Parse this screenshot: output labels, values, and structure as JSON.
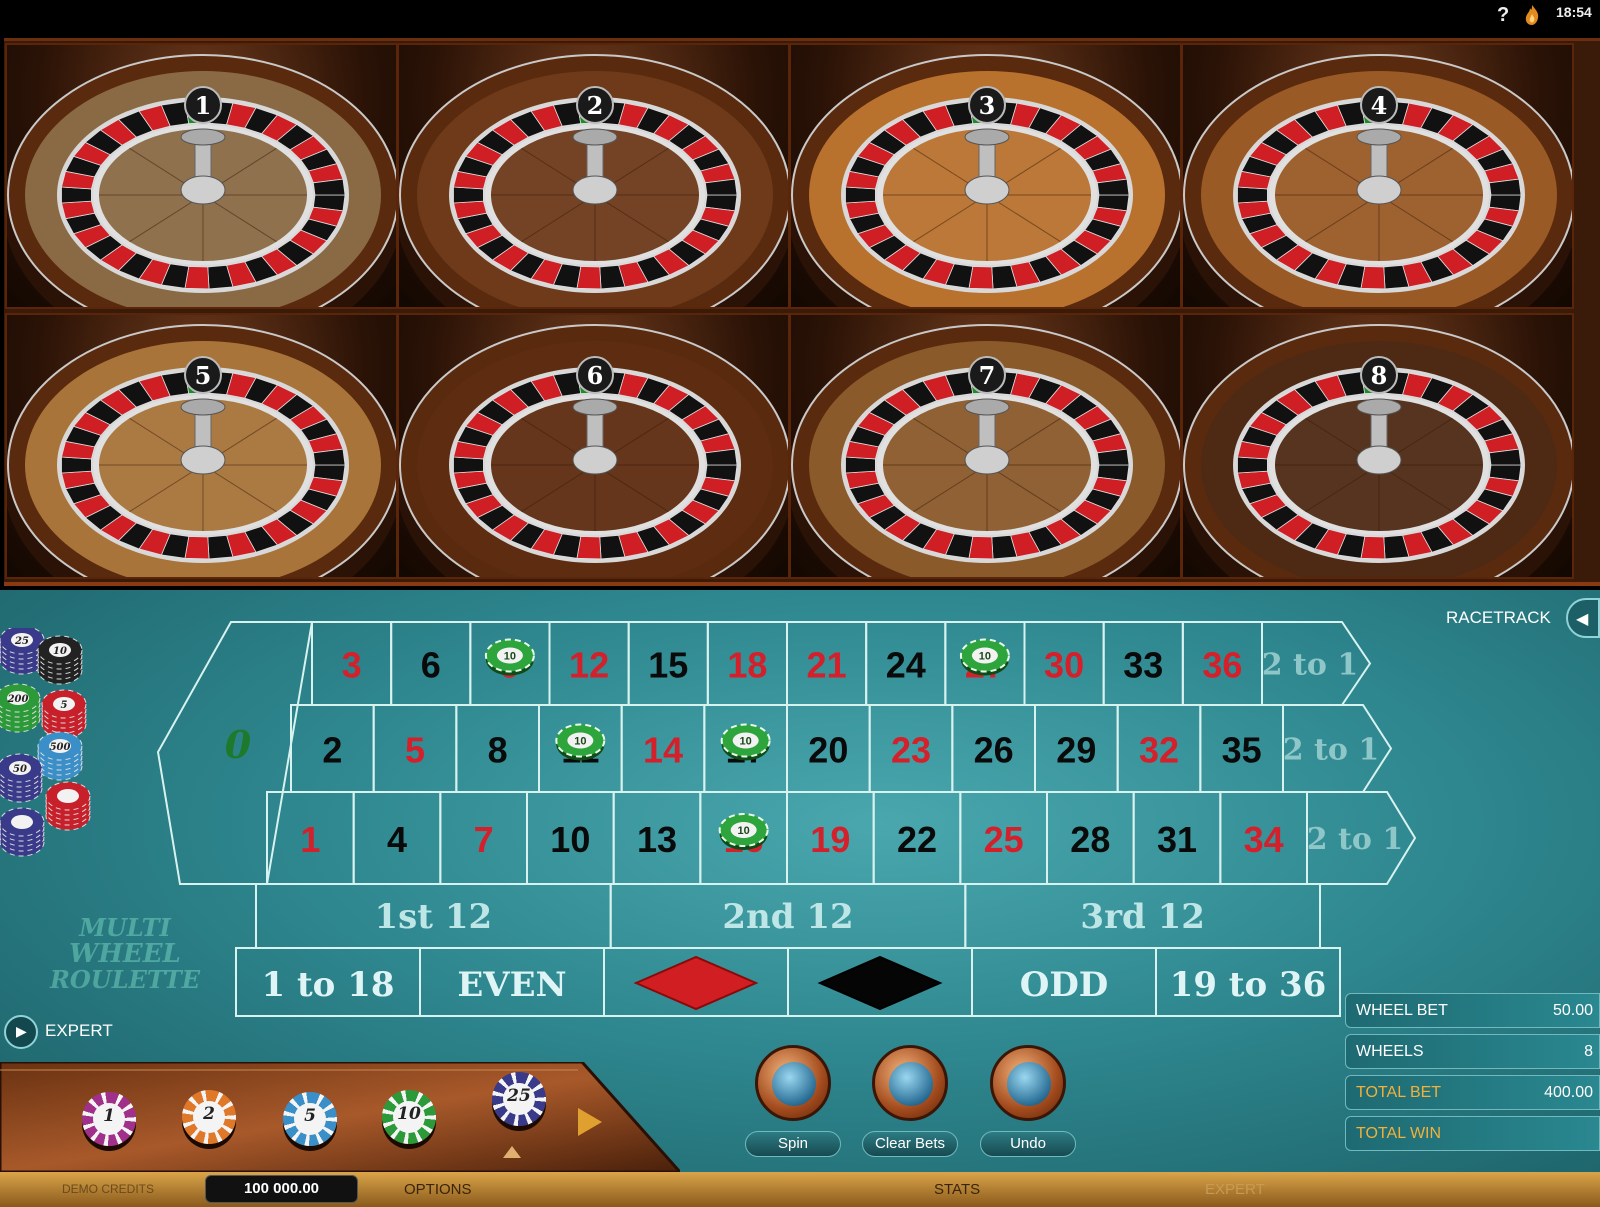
{
  "topbar": {
    "help_label": "?",
    "clock": "18:54"
  },
  "wheels": [
    {
      "number": "1"
    },
    {
      "number": "2"
    },
    {
      "number": "3"
    },
    {
      "number": "4"
    },
    {
      "number": "5"
    },
    {
      "number": "6"
    },
    {
      "number": "7"
    },
    {
      "number": "8"
    }
  ],
  "table": {
    "zero": "0",
    "rows": [
      [
        {
          "n": "3",
          "c": "red"
        },
        {
          "n": "6",
          "c": "black"
        },
        {
          "n": "9",
          "c": "red"
        },
        {
          "n": "12",
          "c": "red"
        },
        {
          "n": "15",
          "c": "black"
        },
        {
          "n": "18",
          "c": "red"
        },
        {
          "n": "21",
          "c": "red"
        },
        {
          "n": "24",
          "c": "black"
        },
        {
          "n": "27",
          "c": "red"
        },
        {
          "n": "30",
          "c": "red"
        },
        {
          "n": "33",
          "c": "black"
        },
        {
          "n": "36",
          "c": "red"
        }
      ],
      [
        {
          "n": "2",
          "c": "black"
        },
        {
          "n": "5",
          "c": "red"
        },
        {
          "n": "8",
          "c": "black"
        },
        {
          "n": "11",
          "c": "black"
        },
        {
          "n": "14",
          "c": "red"
        },
        {
          "n": "17",
          "c": "black"
        },
        {
          "n": "20",
          "c": "black"
        },
        {
          "n": "23",
          "c": "red"
        },
        {
          "n": "26",
          "c": "black"
        },
        {
          "n": "29",
          "c": "black"
        },
        {
          "n": "32",
          "c": "red"
        },
        {
          "n": "35",
          "c": "black"
        }
      ],
      [
        {
          "n": "1",
          "c": "red"
        },
        {
          "n": "4",
          "c": "black"
        },
        {
          "n": "7",
          "c": "red"
        },
        {
          "n": "10",
          "c": "black"
        },
        {
          "n": "13",
          "c": "black"
        },
        {
          "n": "16",
          "c": "red"
        },
        {
          "n": "19",
          "c": "red"
        },
        {
          "n": "22",
          "c": "black"
        },
        {
          "n": "25",
          "c": "red"
        },
        {
          "n": "28",
          "c": "black"
        },
        {
          "n": "31",
          "c": "black"
        },
        {
          "n": "34",
          "c": "red"
        }
      ]
    ],
    "column_bets": [
      "2 to 1",
      "2 to 1",
      "2 to 1"
    ],
    "dozens": [
      "1st 12",
      "2nd 12",
      "3rd 12"
    ],
    "outside": [
      "1 to 18",
      "EVEN",
      "ODD",
      "19 to 36"
    ],
    "placed_chips": [
      {
        "row": 0,
        "col": 2,
        "value": "10"
      },
      {
        "row": 0,
        "col": 8,
        "value": "10"
      },
      {
        "row": 1,
        "col": 3,
        "value": "10"
      },
      {
        "row": 1,
        "col": 5,
        "value": "10"
      },
      {
        "row": 2,
        "col": 5,
        "value": "10"
      }
    ]
  },
  "racetrack": {
    "label": "RACETRACK"
  },
  "expert": {
    "label": "EXPERT"
  },
  "logo": {
    "line1": "MULTI",
    "line2": "WHEEL",
    "line3": "ROULETTE"
  },
  "chip_tray": {
    "chips": [
      {
        "value": "1",
        "color": "#a0308a"
      },
      {
        "value": "2",
        "color": "#e0782a"
      },
      {
        "value": "5",
        "color": "#3a8fc8"
      },
      {
        "value": "10",
        "color": "#2d9a3a"
      },
      {
        "value": "25",
        "color": "#3a3a8a"
      }
    ]
  },
  "actions": {
    "spin": "Spin",
    "clear": "Clear Bets",
    "undo": "Undo"
  },
  "info": {
    "wheel_bet_label": "WHEEL BET",
    "wheel_bet_value": "50.00",
    "wheels_label": "WHEELS",
    "wheels_value": "8",
    "total_bet_label": "TOTAL BET",
    "total_bet_value": "400.00",
    "total_win_label": "TOTAL WIN"
  },
  "stack_chips": [
    "25",
    "10",
    "200",
    "5",
    "500",
    "50"
  ],
  "bottombar": {
    "demo_label": "DEMO CREDITS",
    "credits": "100 000.00",
    "options": "OPTIONS",
    "stats": "STATS",
    "expert": "EXPERT"
  },
  "colors": {
    "felt": "#2f8890",
    "red": "#d4202a",
    "black": "#0a0a0a",
    "zero_green": "#1d7a2a",
    "gold": "#f2b13a"
  }
}
